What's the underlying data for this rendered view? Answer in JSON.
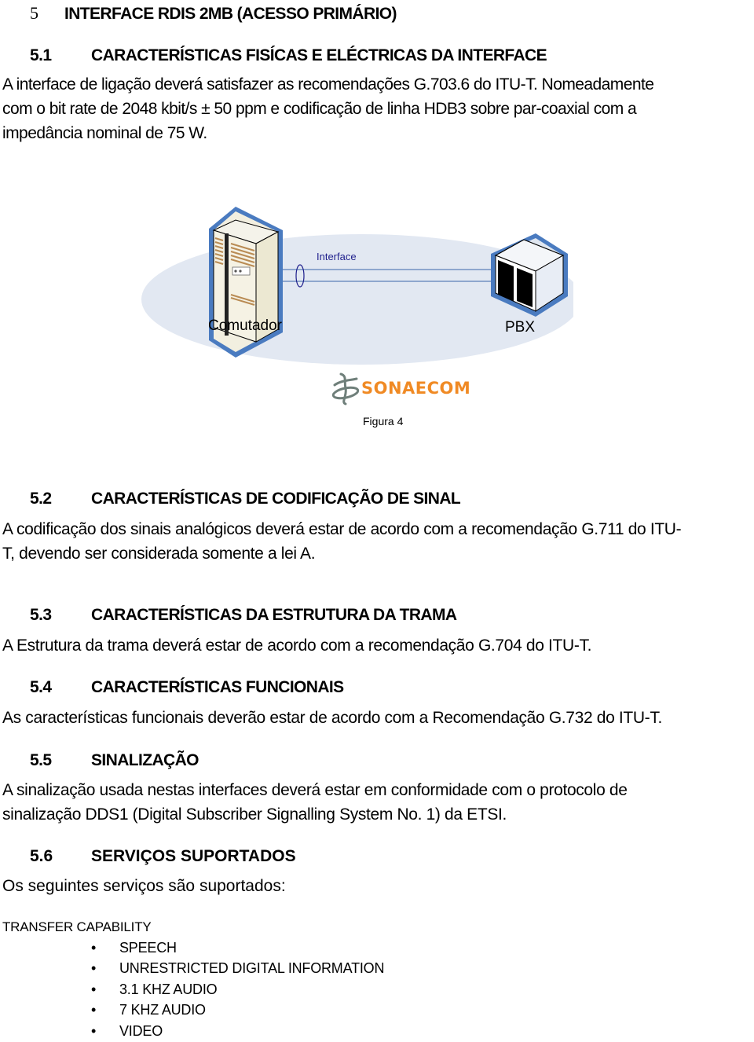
{
  "section": {
    "number": "5",
    "title": "INTERFACE RDIS 2MB (ACESSO PRIMÁRIO)"
  },
  "subsections": [
    {
      "number": "5.1",
      "title": "CARACTERÍSTICAS FISÍCAS E ELÉCTRICAS DA INTERFACE",
      "lines": [
        "A interface de ligação deverá satisfazer as recomendações G.703.6 do ITU-T. Nomeadamente",
        "com o bit rate de 2048 kbit/s ± 50 ppm e codificação de linha HDB3 sobre par-coaxial com a",
        "impedância nominal de 75 W."
      ]
    },
    {
      "number": "5.2",
      "title": "CARACTERÍSTICAS DE CODIFICAÇÃO DE SINAL",
      "lines": [
        "A codificação dos sinais analógicos deverá estar de acordo com a recomendação G.711 do ITU-",
        "T, devendo ser considerada somente a lei A."
      ]
    },
    {
      "number": "5.3",
      "title": "CARACTERÍSTICAS DA ESTRUTURA DA TRAMA",
      "lines": [
        "A Estrutura da trama deverá estar de acordo com a recomendação G.704 do ITU-T."
      ]
    },
    {
      "number": "5.4",
      "title": "CARACTERÍSTICAS FUNCIONAIS",
      "lines": [
        "As características funcionais deverão estar de acordo com a Recomendação G.732 do ITU-T."
      ]
    },
    {
      "number": "5.5",
      "title": "SINALIZAÇÃO",
      "lines": [
        "A sinalização usada nestas interfaces deverá estar em conformidade com o protocolo de",
        "sinalização DDS1 (Digital Subscriber Signalling System No. 1) da ETSI."
      ]
    },
    {
      "number": "5.6",
      "title": "SERVIÇOS SUPORTADOS",
      "lines": [
        "Os seguintes serviços são suportados:"
      ]
    }
  ],
  "figure": {
    "left_label": "Comutador",
    "right_label": "PBX",
    "link_label": "Interface",
    "logo_text": "SONAECOM",
    "caption": "Figura 4",
    "colors": {
      "ellipse": "#e2e8f2",
      "device_outline": "#4a7bc0",
      "link_line": "#5b80b8",
      "link_label": "#1e1e8c",
      "logo_orange": "#f08a24",
      "logo_grey": "#6f7f7a"
    }
  },
  "transfer_capability": {
    "heading": "TRANSFER CAPABILITY",
    "items": [
      "SPEECH",
      "UNRESTRICTED DIGITAL INFORMATION",
      "3.1 KHZ AUDIO",
      "7 KHZ AUDIO",
      "VIDEO"
    ],
    "bullet": "•"
  }
}
